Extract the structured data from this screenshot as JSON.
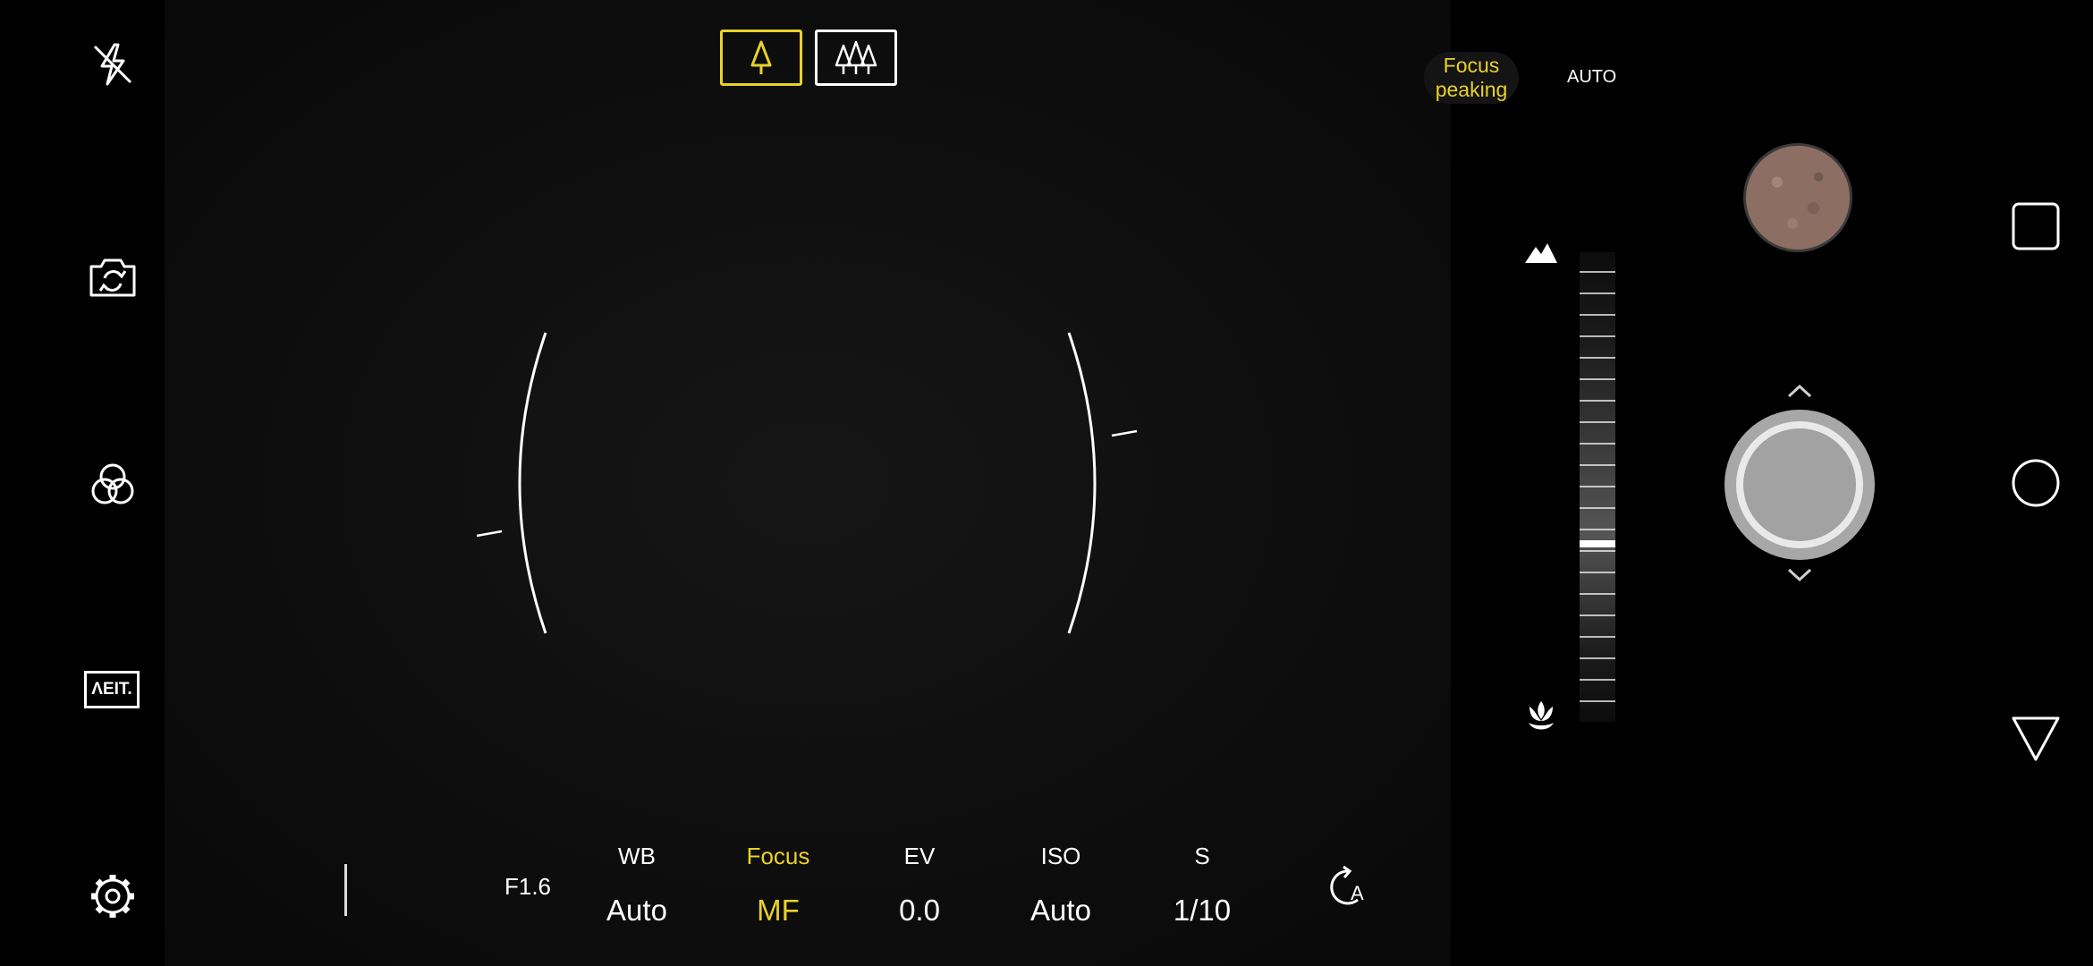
{
  "top": {
    "lens_single": "single-tree-icon",
    "lens_wide": "trees-icon"
  },
  "left_rail": {
    "flash": "flash-off-icon",
    "switch_camera": "camera-switch-icon",
    "filters": "filter-circles-icon",
    "lang_badge": "ΛEIT.",
    "settings": "gear-icon"
  },
  "settings_bar": {
    "aperture": "F1.6",
    "items": [
      {
        "key": "WB",
        "value": "Auto",
        "active": false
      },
      {
        "key": "Focus",
        "value": "MF",
        "active": true
      },
      {
        "key": "EV",
        "value": "0.0",
        "active": false
      },
      {
        "key": "ISO",
        "value": "Auto",
        "active": false
      },
      {
        "key": "S",
        "value": "1/10",
        "active": false
      }
    ],
    "reset_auto": "A"
  },
  "focus_panel": {
    "peaking_label": "Focus peaking",
    "mode_label": "AUTO",
    "far_icon": "mountain-icon",
    "near_icon": "macro-flower-icon",
    "focus_level": 0.62
  },
  "colors": {
    "accent": "#e8d12b",
    "text": "#ffffff"
  },
  "nav": {
    "recents": "square-icon",
    "home": "circle-icon",
    "back": "triangle-back-icon"
  }
}
